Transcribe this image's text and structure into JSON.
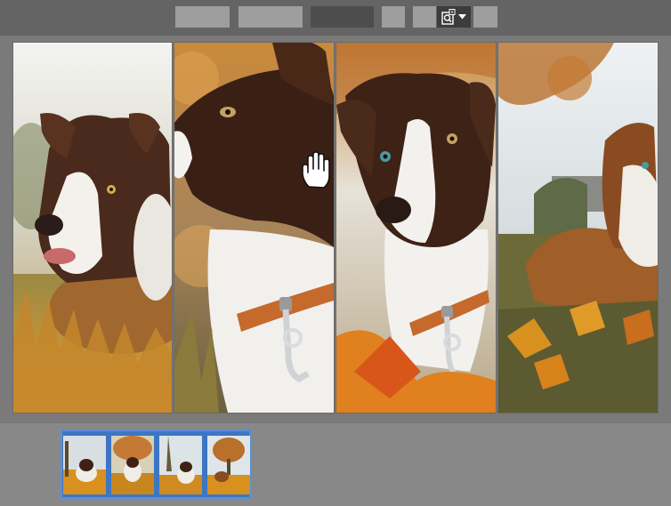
{
  "toolbar": {
    "buttons": [
      {
        "name": "toolbar-button-1"
      },
      {
        "name": "toolbar-button-2"
      },
      {
        "name": "toolbar-button-3"
      },
      {
        "name": "toolbar-button-4"
      },
      {
        "name": "toolbar-button-5"
      },
      {
        "name": "toolbar-button-6"
      }
    ],
    "zoom_icon": "zoom-page-icon"
  },
  "viewer": {
    "panels": [
      {
        "subject": "puppy-grass"
      },
      {
        "subject": "puppy-profile"
      },
      {
        "subject": "puppy-closeup"
      },
      {
        "subject": "puppy-leaves"
      }
    ],
    "cursor_icon": "hand-icon"
  },
  "filmstrip": {
    "thumbnails": 4,
    "selected": true
  },
  "colors": {
    "toolbar": "#646464",
    "workspace": "#888888",
    "filmstrip_selection": "#3d76c2"
  }
}
